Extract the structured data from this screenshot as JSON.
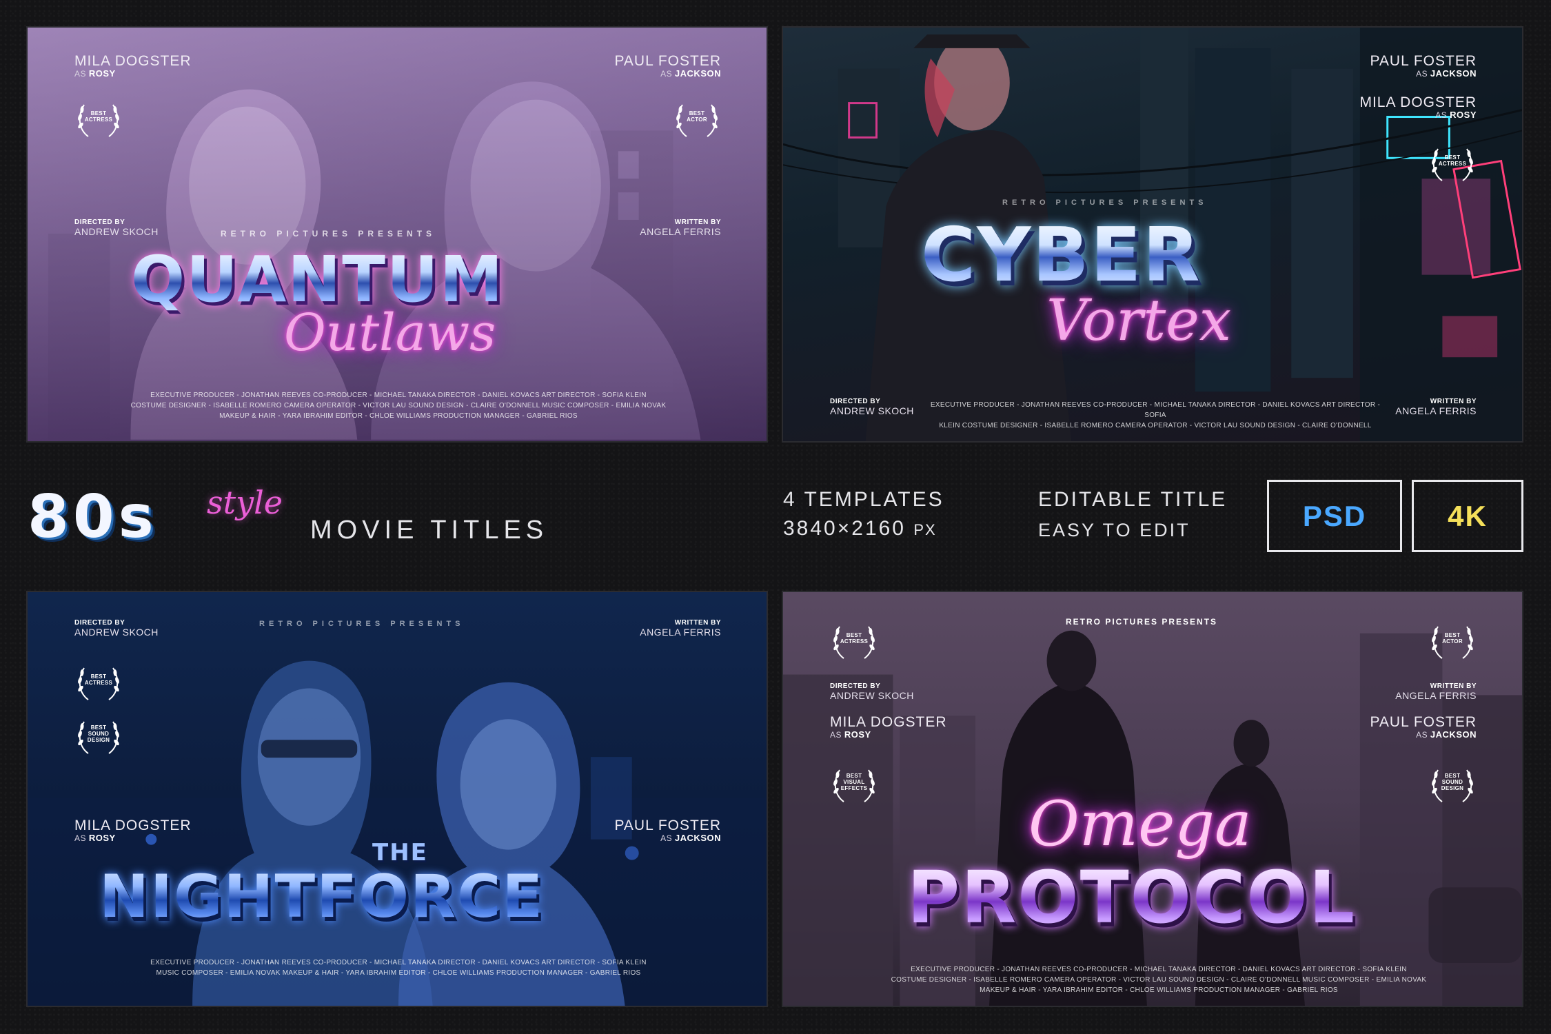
{
  "panels": {
    "p1": {
      "actress": {
        "name": "MILA DOGSTER",
        "as": "AS",
        "role": "ROSY"
      },
      "actor": {
        "name": "PAUL FOSTER",
        "as": "AS",
        "role": "JACKSON"
      },
      "award_left": "BEST\nACTRESS",
      "award_right": "BEST\nACTOR",
      "directed_by_label": "DIRECTED BY",
      "director": "ANDREW SKOCH",
      "written_by_label": "WRITTEN BY",
      "writer": "ANGELA FERRIS",
      "presents": "RETRO PICTURES PRESENTS",
      "title_main": "QUANTUM",
      "title_script": "Outlaws",
      "credits_line1": "EXECUTIVE PRODUCER - JONATHAN REEVES   CO-PRODUCER - MICHAEL TANAKA   DIRECTOR - DANIEL KOVACS   ART DIRECTOR - SOFIA KLEIN",
      "credits_line2": "COSTUME DESIGNER - ISABELLE ROMERO   CAMERA OPERATOR - VICTOR LAU   SOUND DESIGN - CLAIRE O'DONNELL   MUSIC COMPOSER - EMILIA NOVAK",
      "credits_line3": "MAKEUP & HAIR - YARA IBRAHIM   EDITOR - CHLOE WILLIAMS   PRODUCTION MANAGER - GABRIEL RIOS"
    },
    "p2": {
      "actor": {
        "name": "PAUL FOSTER",
        "as": "AS",
        "role": "JACKSON"
      },
      "actress": {
        "name": "MILA DOGSTER",
        "as": "AS",
        "role": "ROSY"
      },
      "award_right": "BEST\nACTRESS",
      "presents": "RETRO PICTURES PRESENTS",
      "title_main": "CYBER",
      "title_script": "Vortex",
      "directed_by_label": "DIRECTED BY",
      "director": "ANDREW SKOCH",
      "written_by_label": "WRITTEN BY",
      "writer": "ANGELA FERRIS",
      "credits_line1": "EXECUTIVE PRODUCER - JONATHAN REEVES   CO-PRODUCER - MICHAEL TANAKA   DIRECTOR - DANIEL KOVACS   ART DIRECTOR - SOFIA",
      "credits_line2": "KLEIN   COSTUME DESIGNER - ISABELLE ROMERO   CAMERA OPERATOR - VICTOR LAU   SOUND DESIGN - CLAIRE O'DONNELL"
    },
    "p3": {
      "directed_by_label": "DIRECTED BY",
      "director": "ANDREW SKOCH",
      "written_by_label": "WRITTEN BY",
      "writer": "ANGELA FERRIS",
      "presents": "RETRO PICTURES PRESENTS",
      "award_1": "BEST\nACTRESS",
      "award_2": "BEST\nSOUND\nDESIGN",
      "actress": {
        "name": "MILA DOGSTER",
        "as": "AS",
        "role": "ROSY"
      },
      "actor": {
        "name": "PAUL FOSTER",
        "as": "AS",
        "role": "JACKSON"
      },
      "title_small": "THE",
      "title_main": "NIGHTFORCE",
      "credits_line1": "EXECUTIVE PRODUCER - JONATHAN REEVES   CO-PRODUCER - MICHAEL TANAKA   DIRECTOR - DANIEL KOVACS   ART DIRECTOR - SOFIA KLEIN",
      "credits_line2": "MUSIC COMPOSER - EMILIA NOVAK   MAKEUP & HAIR - YARA IBRAHIM   EDITOR - CHLOE WILLIAMS   PRODUCTION MANAGER - GABRIEL RIOS"
    },
    "p4": {
      "presents": "RETRO PICTURES PRESENTS",
      "award_tl": "BEST\nACTRESS",
      "award_tr": "BEST\nACTOR",
      "award_bl": "BEST\nVISUAL\nEFFECTS",
      "award_br": "BEST\nSOUND\nDESIGN",
      "directed_by_label": "DIRECTED BY",
      "director": "ANDREW SKOCH",
      "written_by_label": "WRITTEN BY",
      "writer": "ANGELA FERRIS",
      "actress": {
        "name": "MILA DOGSTER",
        "as": "AS",
        "role": "ROSY"
      },
      "actor": {
        "name": "PAUL FOSTER",
        "as": "AS",
        "role": "JACKSON"
      },
      "title_script": "Omega",
      "title_main": "PROTOCOL",
      "credits_line1": "EXECUTIVE PRODUCER - JONATHAN REEVES   CO-PRODUCER - MICHAEL TANAKA   DIRECTOR - DANIEL KOVACS   ART DIRECTOR - SOFIA KLEIN",
      "credits_line2": "COSTUME DESIGNER - ISABELLE ROMERO   CAMERA OPERATOR - VICTOR LAU   SOUND DESIGN - CLAIRE O'DONNELL   MUSIC COMPOSER - EMILIA NOVAK",
      "credits_line3": "MAKEUP & HAIR - YARA IBRAHIM   EDITOR - CHLOE WILLIAMS   PRODUCTION MANAGER - GABRIEL RIOS"
    }
  },
  "band": {
    "logo_80s": "80s",
    "logo_style": "style",
    "logo_sub": "MOVIE TITLES",
    "templates_count": "4 TEMPLATES",
    "resolution": "3840×2160",
    "resolution_unit": "PX",
    "feature_1": "EDITABLE TITLE",
    "feature_2": "EASY TO EDIT",
    "badge_psd": "PSD",
    "badge_4k": "4K"
  },
  "colors": {
    "psd": "#4aa8ff",
    "fourk": "#f5e05a",
    "neon_pink": "#ec5fd8",
    "chrome_blue": "#3a7dd8"
  }
}
